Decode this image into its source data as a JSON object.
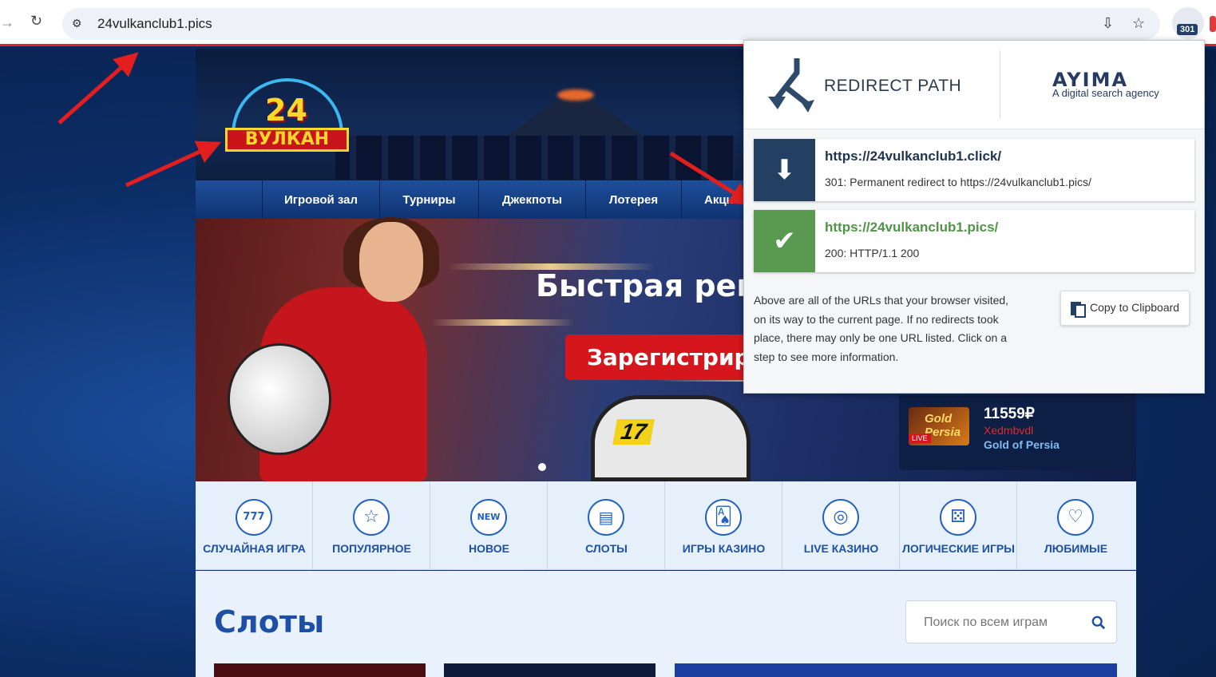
{
  "browser": {
    "url": "24vulkanclub1.pics",
    "extension_badge": "301"
  },
  "site": {
    "logo_number": "24",
    "logo_word": "ВУЛКАН",
    "menu": [
      "Игровой зал",
      "Турниры",
      "Джекпоты",
      "Лотерея",
      "Акци"
    ],
    "banner_title": "Быстрая регис",
    "register_button": "Зарегистриров",
    "kart_number": "17",
    "jackpot": {
      "amount": "11559₽",
      "user": "Xedmbvdl",
      "game": "Gold of Persia",
      "thumb_text": "Gold Persia",
      "live_badge": "LIVE"
    },
    "categories": [
      {
        "label": "СЛУЧАЙНАЯ ИГРА",
        "icon": "777-icon",
        "glyph": "777"
      },
      {
        "label": "ПОПУЛЯРНОЕ",
        "icon": "star-icon",
        "glyph": "☆"
      },
      {
        "label": "НОВОЕ",
        "icon": "new-icon",
        "glyph": "NEW"
      },
      {
        "label": "СЛОТЫ",
        "icon": "slot-machine-icon",
        "glyph": "▤"
      },
      {
        "label": "ИГРЫ КАЗИНО",
        "icon": "cards-icon",
        "glyph": "🂡"
      },
      {
        "label": "LIVE КАЗИНО",
        "icon": "roulette-icon",
        "glyph": "◎"
      },
      {
        "label": "ЛОГИЧЕСКИЕ ИГРЫ",
        "icon": "dice-icon",
        "glyph": "⚄"
      },
      {
        "label": "ЛЮБИМЫЕ",
        "icon": "heart-icon",
        "glyph": "♡"
      }
    ],
    "section_title": "Слоты",
    "search_placeholder": "Поиск по всем играм"
  },
  "popup": {
    "brand": "REDIRECT PATH",
    "partner": "AYIMA",
    "partner_sub": "A digital search agency",
    "steps": [
      {
        "url": "https://24vulkanclub1.click/",
        "desc": "301: Permanent redirect to https://24vulkanclub1.pics/",
        "color": "#233f61",
        "icon": "arrow-down-icon",
        "glyph": "⬇"
      },
      {
        "url": "https://24vulkanclub1.pics/",
        "desc": "200: HTTP/1.1 200",
        "color": "#5a9a50",
        "icon": "checkmark-icon",
        "glyph": "✔"
      }
    ],
    "note": "Above are all of the URLs that your browser visited, on its way to the current page. If no redirects took place, there may only be one URL listed. Click on a step to see more information.",
    "copy_button": "Copy to Clipboard"
  },
  "colors": {
    "accent_red": "#d6161d",
    "brand_blue": "#1d4fa6",
    "redirect_step": "#233f61",
    "ok_step": "#5a9a50"
  }
}
